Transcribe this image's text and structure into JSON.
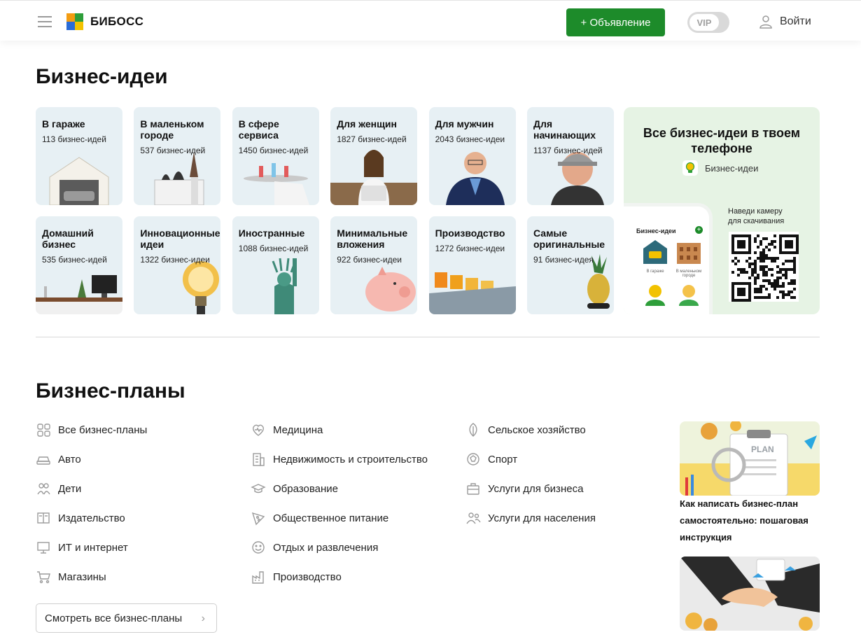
{
  "header": {
    "logo_text": "БИБОСС",
    "ad_button": "+ Объявление",
    "vip_label": "VIP",
    "login": "Войти",
    "colors": {
      "accent": "#1d8b2a",
      "logo_orange": "#f39c12",
      "logo_green": "#2e9e3a",
      "logo_blue": "#2b6cd6",
      "logo_yellow": "#f2c200"
    }
  },
  "ideas": {
    "title": "Бизнес-идеи",
    "tiles": [
      {
        "title": "В гараже",
        "count": "113 бизнес-идей",
        "icon": "garage-image"
      },
      {
        "title": "В маленьком городе",
        "count": "537 бизнес-идей",
        "icon": "church-image"
      },
      {
        "title": "В сфере сервиса",
        "count": "1450 бизнес-идей",
        "icon": "waiter-tray-image"
      },
      {
        "title": "Для женщин",
        "count": "1827 бизнес-идей",
        "icon": "woman-laptop-image"
      },
      {
        "title": "Для мужчин",
        "count": "2043 бизнес-идеи",
        "icon": "man-phone-image"
      },
      {
        "title": "Для начинающих",
        "count": "1137 бизнес-идей",
        "icon": "cap-man-image"
      },
      {
        "title": "Домашний бизнес",
        "count": "535 бизнес-идей",
        "icon": "home-desk-image"
      },
      {
        "title": "Инновационные идеи",
        "count": "1322 бизнес-идеи",
        "icon": "lightbulb-image"
      },
      {
        "title": "Иностранные",
        "count": "1088 бизнес-идей",
        "icon": "liberty-statue-image"
      },
      {
        "title": "Минимальные вложения",
        "count": "922 бизнес-идеи",
        "icon": "piggy-bank-image"
      },
      {
        "title": "Производство",
        "count": "1272 бизнес-идеи",
        "icon": "factory-image"
      },
      {
        "title": "Самые оригинальные",
        "count": "91 бизнес-идея",
        "icon": "pineapple-image"
      }
    ],
    "promo": {
      "title": "Все бизнес-идеи в твоем телефоне",
      "app_name": "Бизнес-идеи",
      "phone_title": "Бизнес-идеи",
      "phone_label_1": "В гараже",
      "phone_label_2": "В маленьком городе",
      "qr_caption_1": "Наведи камеру",
      "qr_caption_2": "для скачивания"
    }
  },
  "plans": {
    "title": "Бизнес-планы",
    "col1": [
      {
        "label": "Все бизнес-планы",
        "icon": "grid-icon"
      },
      {
        "label": "Авто",
        "icon": "car-icon"
      },
      {
        "label": "Дети",
        "icon": "kids-icon"
      },
      {
        "label": "Издательство",
        "icon": "book-icon"
      },
      {
        "label": "ИТ и интернет",
        "icon": "monitor-icon"
      },
      {
        "label": "Магазины",
        "icon": "cart-icon"
      }
    ],
    "col2": [
      {
        "label": "Медицина",
        "icon": "heart-pulse-icon"
      },
      {
        "label": "Недвижимость и строительство",
        "icon": "building-icon"
      },
      {
        "label": "Образование",
        "icon": "graduation-cap-icon"
      },
      {
        "label": "Общественное питание",
        "icon": "pizza-icon"
      },
      {
        "label": "Отдых и развлечения",
        "icon": "smile-icon"
      },
      {
        "label": "Производство",
        "icon": "factory-icon"
      }
    ],
    "col3": [
      {
        "label": "Сельское хозяйство",
        "icon": "leaf-icon"
      },
      {
        "label": "Спорт",
        "icon": "ball-icon"
      },
      {
        "label": "Услуги для бизнеса",
        "icon": "briefcase-icon"
      },
      {
        "label": "Услуги для населения",
        "icon": "people-icon"
      }
    ],
    "all_button": "Смотреть все бизнес-планы",
    "articles": [
      {
        "title": "Как написать бизнес-план самостоятельно: пошаговая инструкция",
        "image_text": "PLAN"
      }
    ]
  }
}
